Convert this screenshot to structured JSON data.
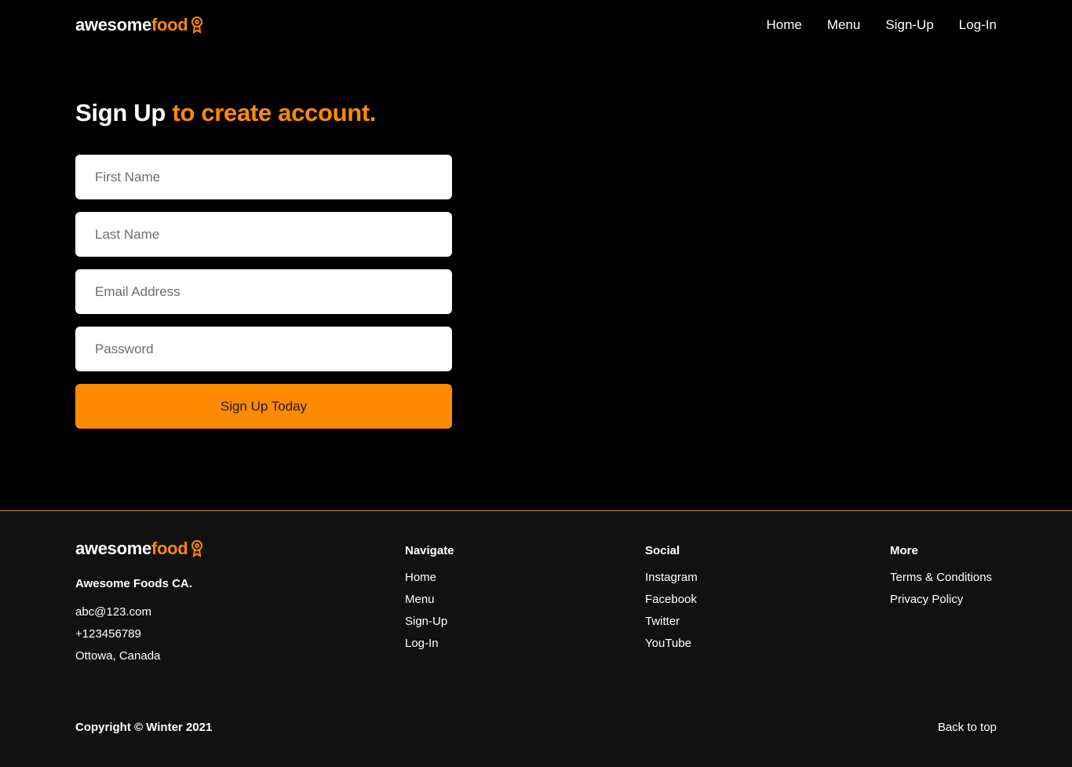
{
  "brand": {
    "name_part1": "awesome",
    "name_part2": "food",
    "icon": "award-badge-icon",
    "accent_color": "#ff8a00"
  },
  "nav": {
    "items": [
      {
        "label": "Home"
      },
      {
        "label": "Menu"
      },
      {
        "label": "Sign-Up"
      },
      {
        "label": "Log-In"
      }
    ]
  },
  "hero": {
    "title_white": "Sign Up",
    "title_orange": "to create account."
  },
  "form": {
    "first_name_placeholder": "First Name",
    "last_name_placeholder": "Last Name",
    "email_placeholder": "Email Address",
    "password_placeholder": "Password",
    "submit_label": "Sign Up Today"
  },
  "footer": {
    "company": "Awesome Foods CA.",
    "email": "abc@123.com",
    "phone": "+123456789",
    "location": "Ottowa, Canada",
    "navigate": {
      "heading": "Navigate",
      "links": [
        "Home",
        "Menu",
        "Sign-Up",
        "Log-In"
      ]
    },
    "social": {
      "heading": "Social",
      "links": [
        "Instagram",
        "Facebook",
        "Twitter",
        "YouTube"
      ]
    },
    "more": {
      "heading": "More",
      "links": [
        "Terms & Conditions",
        "Privacy Policy"
      ]
    },
    "copyright": "Copyright © Winter 2021",
    "back_to_top": "Back to top"
  }
}
